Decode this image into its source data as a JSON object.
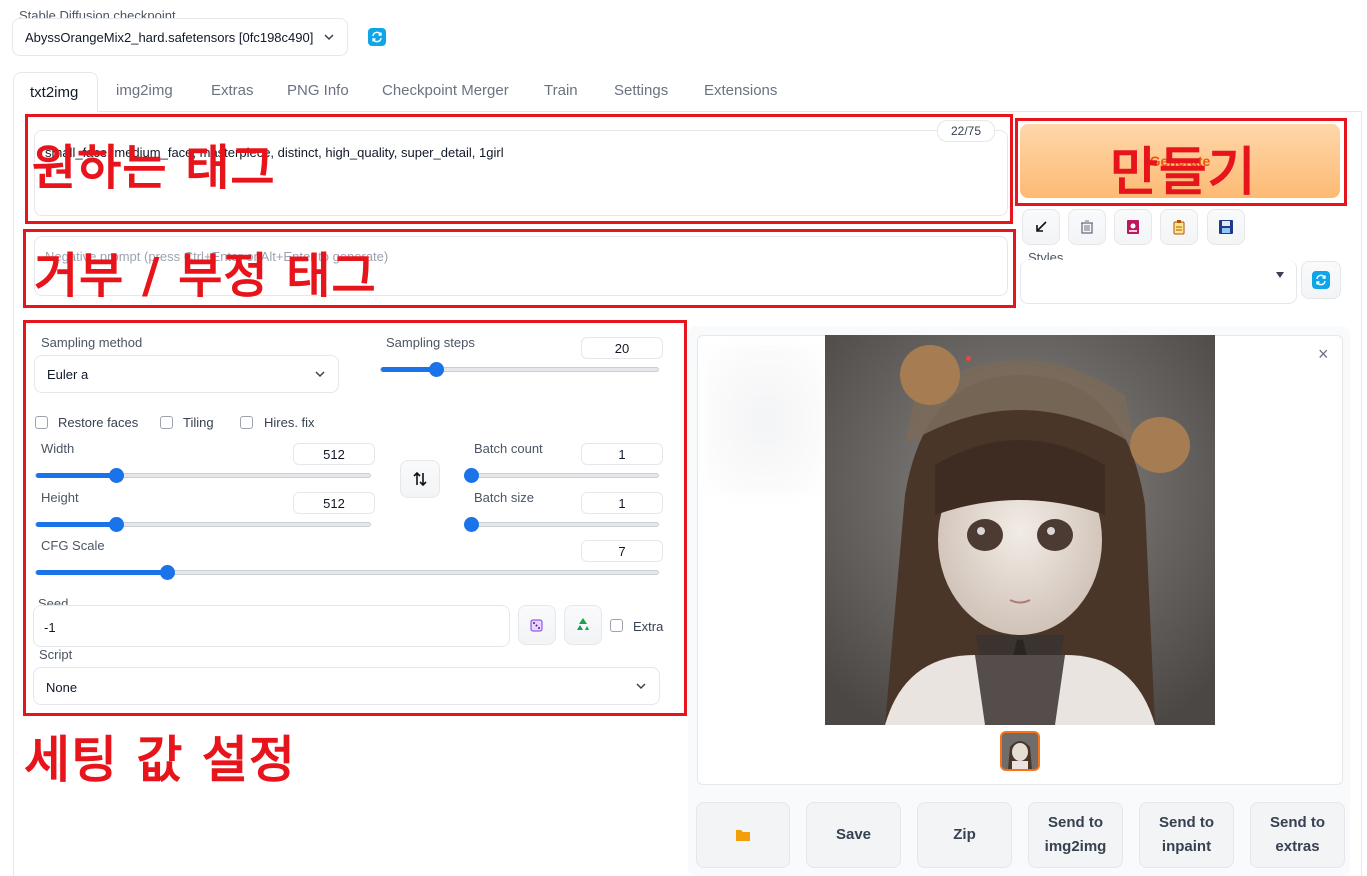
{
  "checkpoint": {
    "label": "Stable Diffusion checkpoint",
    "value": "AbyssOrangeMix2_hard.safetensors [0fc198c490]"
  },
  "tabs": [
    "txt2img",
    "img2img",
    "Extras",
    "PNG Info",
    "Checkpoint Merger",
    "Train",
    "Settings",
    "Extensions"
  ],
  "prompt": {
    "value": "small_face, medium_face, masterpiece, distinct, high_quality, super_detail, 1girl",
    "token_count": "22/75"
  },
  "negative_prompt": {
    "placeholder": "Negative prompt (press Ctrl+Enter or Alt+Enter to generate)"
  },
  "generate": {
    "label": "Generate"
  },
  "styles": {
    "label": "Styles"
  },
  "sampling": {
    "method_label": "Sampling method",
    "method_value": "Euler a",
    "steps_label": "Sampling steps",
    "steps_value": "20",
    "steps_level": 0.2
  },
  "checkboxes": {
    "restore_faces": "Restore faces",
    "tiling": "Tiling",
    "hires_fix": "Hires. fix"
  },
  "width": {
    "label": "Width",
    "value": "512",
    "level": 0.24
  },
  "height": {
    "label": "Height",
    "value": "512",
    "level": 0.24
  },
  "batch_count": {
    "label": "Batch count",
    "value": "1",
    "level": 0.0
  },
  "batch_size": {
    "label": "Batch size",
    "value": "1",
    "level": 0.0
  },
  "cfg": {
    "label": "CFG Scale",
    "value": "7",
    "level": 0.21
  },
  "seed": {
    "label": "Seed",
    "value": "-1",
    "extra_label": "Extra"
  },
  "script": {
    "label": "Script",
    "value": "None"
  },
  "output_buttons": {
    "save": "Save",
    "zip": "Zip",
    "send_img2img_1": "Send to",
    "send_img2img_2": "img2img",
    "send_inpaint_1": "Send to",
    "send_inpaint_2": "inpaint",
    "send_extras_1": "Send to",
    "send_extras_2": "extras"
  },
  "annotations": {
    "prompt": "원하는 태그",
    "generate": "만들기",
    "negative": "거부 / 부정 태그",
    "settings": "세팅 값 설정"
  },
  "colors": {
    "accent": "#1a73e8",
    "annotation": "#e8141c",
    "generate_bg": "#fdba74"
  }
}
